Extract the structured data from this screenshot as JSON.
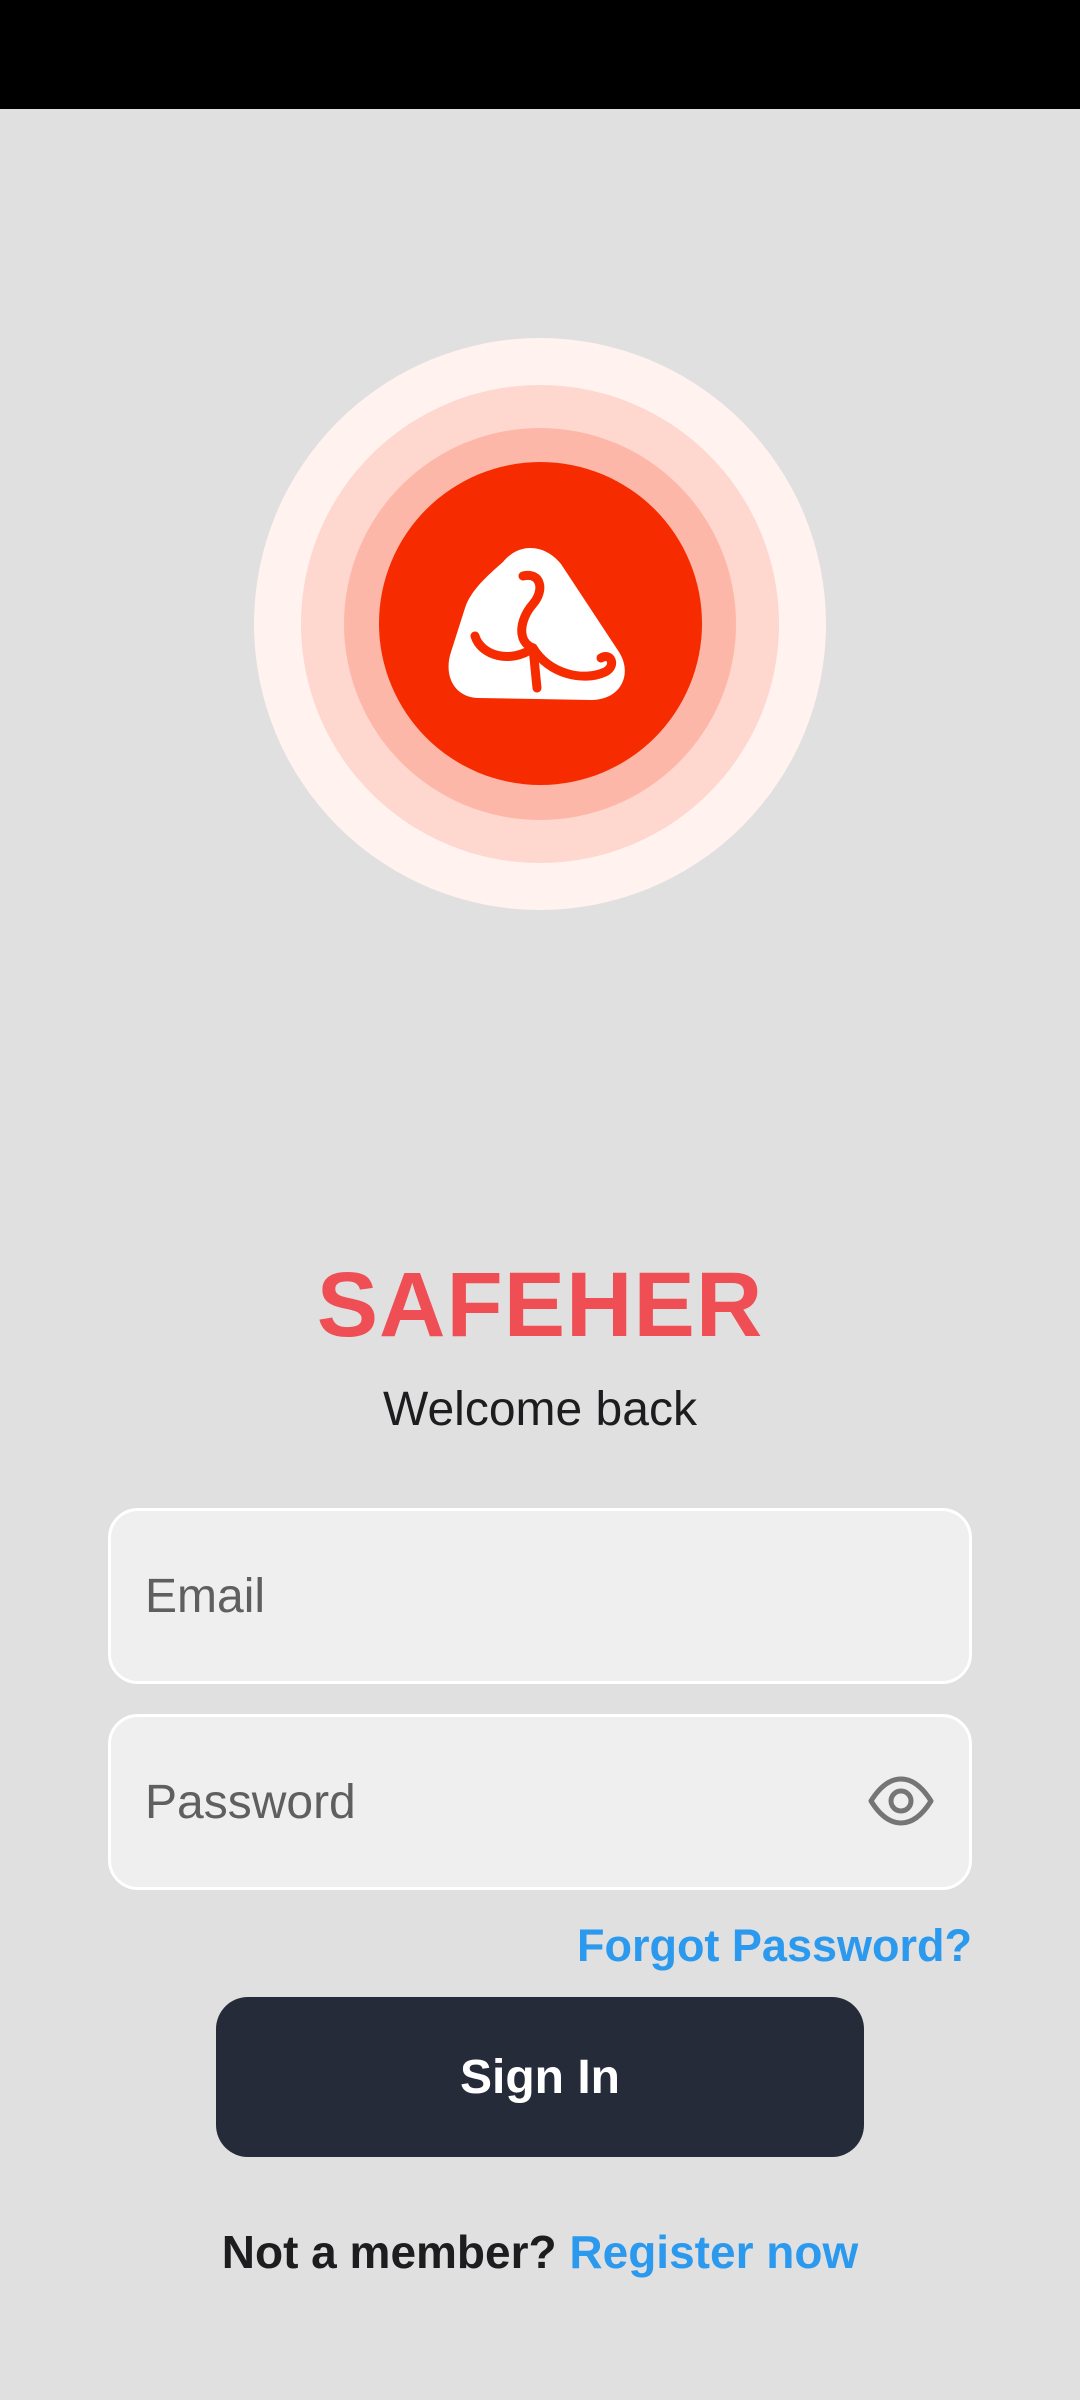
{
  "app": {
    "title": "SAFEHER",
    "subtitle": "Welcome back",
    "brand_color": "#ef4f54",
    "logo_color": "#f72b00",
    "logo_icon": "app-logo-icon"
  },
  "form": {
    "email": {
      "placeholder": "Email",
      "value": ""
    },
    "password": {
      "placeholder": "Password",
      "value": "",
      "toggle_icon": "eye-icon"
    },
    "forgot_label": "Forgot Password?",
    "submit_label": "Sign In"
  },
  "footer": {
    "prompt": "Not a member?",
    "link_label": "Register now"
  },
  "colors": {
    "background": "#e0e0e0",
    "link": "#2a99ee",
    "button": "#262b39"
  }
}
